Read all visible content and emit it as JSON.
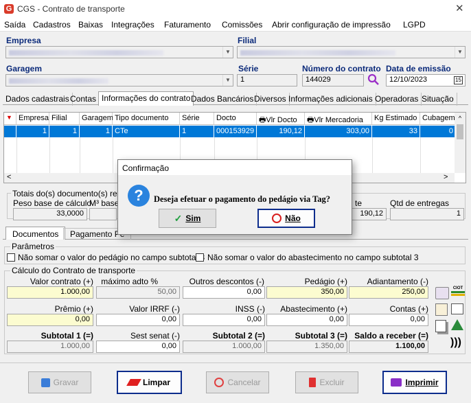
{
  "window": {
    "title": "CGS - Contrato de transporte",
    "logo": "G"
  },
  "menu": [
    "Saída",
    "Cadastros",
    "Baixas",
    "Integrações",
    "Faturamento",
    "Comissões",
    "Abrir configuração de impressão",
    "LGPD"
  ],
  "header": {
    "empresa_label": "Empresa",
    "filial_label": "Filial",
    "garagem_label": "Garagem",
    "serie_label": "Série",
    "serie_value": "1",
    "numero_label": "Número do contrato",
    "numero_value": "144029",
    "emissao_label": "Data de emissão",
    "emissao_value": "12/10/2023"
  },
  "tabs": [
    "Dados cadastrais",
    "Contas",
    "Informações do contrato",
    "Dados Bancários",
    "Diversos",
    "Informações adicionais",
    "Operadoras",
    "Situação"
  ],
  "grid": {
    "headers": [
      "Empresa",
      "Filial",
      "Garagem",
      "Tipo documento",
      "Série",
      "Docto",
      "Vlr Docto",
      "Vlr Mercadoria",
      "Kg Estimado",
      "Cubagem"
    ],
    "row": [
      "1",
      "1",
      "1",
      "CTe",
      "1",
      "000153929",
      "190,12",
      "303,00",
      "33",
      "0"
    ]
  },
  "totais": {
    "title": "Totais do(s) documento(s) relac",
    "peso_label": "Peso base de cálculo",
    "m3_label": "M³ base c",
    "peso_value": "33,0000",
    "te_label": "te",
    "te_value": "190,12",
    "qtd_label": "Qtd de entregas",
    "qtd_value": "1"
  },
  "lower_tabs": [
    "Documentos",
    "Pagamento Pe"
  ],
  "parametros": {
    "title": "Parâmetros",
    "opt1": "Não somar o valor do pedágio no campo subtotal 3",
    "opt2": "Não somar o valor do abastecimento no campo subtotal 3"
  },
  "calculo": {
    "title": "Cálculo do Contrato de transporte",
    "valor_contrato_label": "Valor contrato (+)",
    "valor_contrato": "1.000,00",
    "max_adto_label": "máximo adto %",
    "max_adto": "50,00",
    "outros_label": "Outros descontos (-)",
    "outros": "0,00",
    "pedagio_label": "Pedágio (+)",
    "pedagio": "350,00",
    "adiantamento_label": "Adiantamento (-)",
    "adiantamento": "250,00",
    "premio_label": "Prêmio (+)",
    "premio": "0,00",
    "irrf_label": "Valor IRRF (-)",
    "irrf": "0,00",
    "inss_label": "INSS (-)",
    "inss": "0,00",
    "abastecimento_label": "Abastecimento (+)",
    "abastecimento": "0,00",
    "contas_label": "Contas (+)",
    "contas": "0,00",
    "sub1_label": "Subtotal 1 (=)",
    "sub1": "1.000,00",
    "sest_label": "Sest senat (-)",
    "sest": "0,00",
    "sub2_label": "Subtotal 2 (=)",
    "sub2": "1.000,00",
    "sub3_label": "Subtotal 3 (=)",
    "sub3": "1.350,00",
    "saldo_label": "Saldo a receber (=)",
    "saldo": "1.100,00",
    "ciot_icon_text": "CIOT"
  },
  "buttons": {
    "gravar": "Gravar",
    "limpar": "Limpar",
    "cancelar": "Cancelar",
    "excluir": "Excluir",
    "imprimir": "Imprimir"
  },
  "dialog": {
    "title": "Confirmação",
    "message": "Deseja efetuar o pagamento do pedágio via Tag?",
    "yes": "Sim",
    "no": "Não"
  }
}
